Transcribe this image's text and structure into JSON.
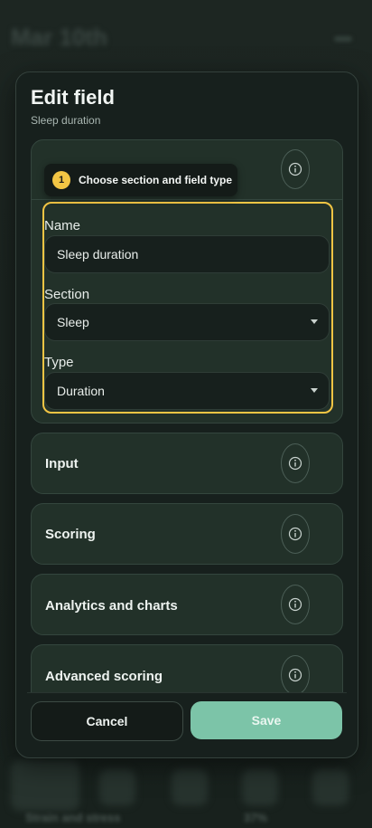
{
  "background": {
    "title": "Mar 10th",
    "footer_left": "Strain and stress",
    "footer_right": "37%"
  },
  "modal": {
    "title": "Edit field",
    "subtitle": "Sleep duration",
    "tooltip": {
      "step": "1",
      "text": "Choose section and field type"
    },
    "fields": {
      "name": {
        "label": "Name",
        "value": "Sleep duration"
      },
      "section": {
        "label": "Section",
        "value": "Sleep"
      },
      "type": {
        "label": "Type",
        "value": "Duration"
      }
    },
    "sections": [
      {
        "title": "Input"
      },
      {
        "title": "Scoring"
      },
      {
        "title": "Analytics and charts"
      },
      {
        "title": "Advanced scoring"
      }
    ],
    "buttons": {
      "cancel": "Cancel",
      "save": "Save"
    },
    "icons": {
      "info": "info-icon",
      "dropdown": "chevron-down-icon"
    },
    "colors": {
      "accent": "#7cc4a8",
      "highlight": "#f2c544"
    }
  }
}
